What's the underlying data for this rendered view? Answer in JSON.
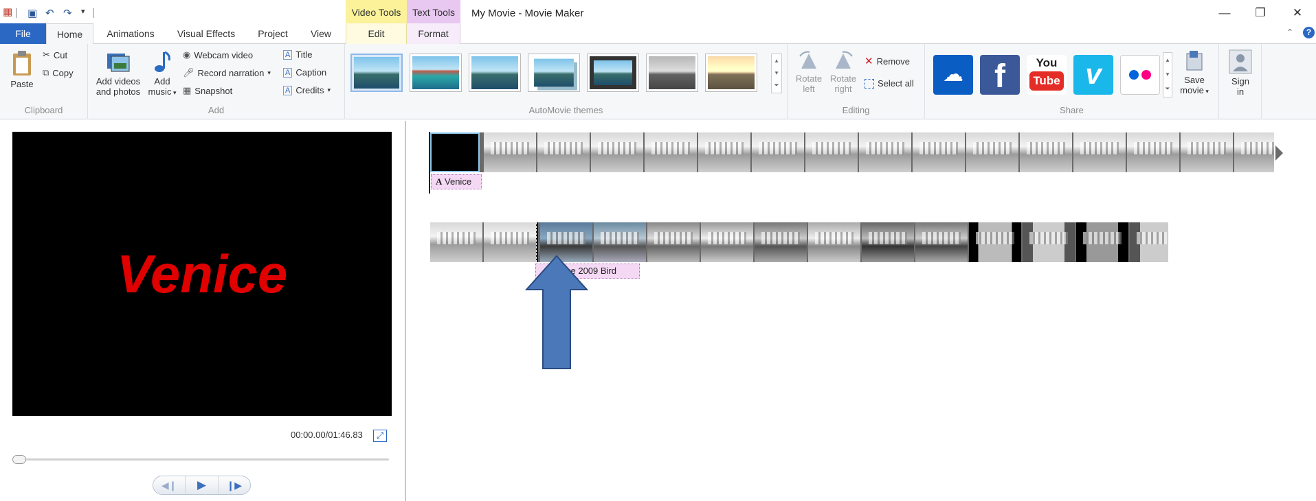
{
  "window": {
    "title": "My Movie - Movie Maker",
    "minimize": "—",
    "restore": "❐",
    "close": "✕"
  },
  "context_tabs": {
    "video_tools": "Video Tools",
    "text_tools": "Text Tools"
  },
  "tabs": {
    "file": "File",
    "home": "Home",
    "animations": "Animations",
    "visual_effects": "Visual Effects",
    "project": "Project",
    "view": "View",
    "edit": "Edit",
    "format": "Format"
  },
  "ribbon": {
    "clipboard": {
      "label": "Clipboard",
      "paste": "Paste",
      "cut": "Cut",
      "copy": "Copy"
    },
    "add": {
      "label": "Add",
      "add_videos": "Add videos",
      "and_photos": "and photos",
      "add_music_1": "Add",
      "add_music_2": "music",
      "webcam": "Webcam video",
      "narration": "Record narration",
      "snapshot": "Snapshot",
      "title": "Title",
      "caption": "Caption",
      "credits": "Credits"
    },
    "themes": {
      "label": "AutoMovie themes"
    },
    "editing": {
      "label": "Editing",
      "rotate_left_1": "Rotate",
      "rotate_left_2": "left",
      "rotate_right_1": "Rotate",
      "rotate_right_2": "right",
      "remove": "Remove",
      "select_all": "Select all"
    },
    "share": {
      "label": "Share",
      "youtube_1": "You",
      "youtube_2": "Tube",
      "facebook": "f",
      "vimeo": "v",
      "save_movie_1": "Save",
      "save_movie_2": "movie",
      "sign_in_1": "Sign",
      "sign_in_2": "in"
    }
  },
  "preview": {
    "text": "Venice",
    "timecode": "00:00.00/01:46.83"
  },
  "timeline": {
    "caption1": "Venice",
    "caption2": "ce 2009 Bird"
  },
  "colors": {
    "file_tab": "#2a68c4",
    "video_tools": "#fbf29a",
    "text_tools": "#e8c7f0",
    "venice_text": "#e00000",
    "arrow": "#4a78b8"
  }
}
